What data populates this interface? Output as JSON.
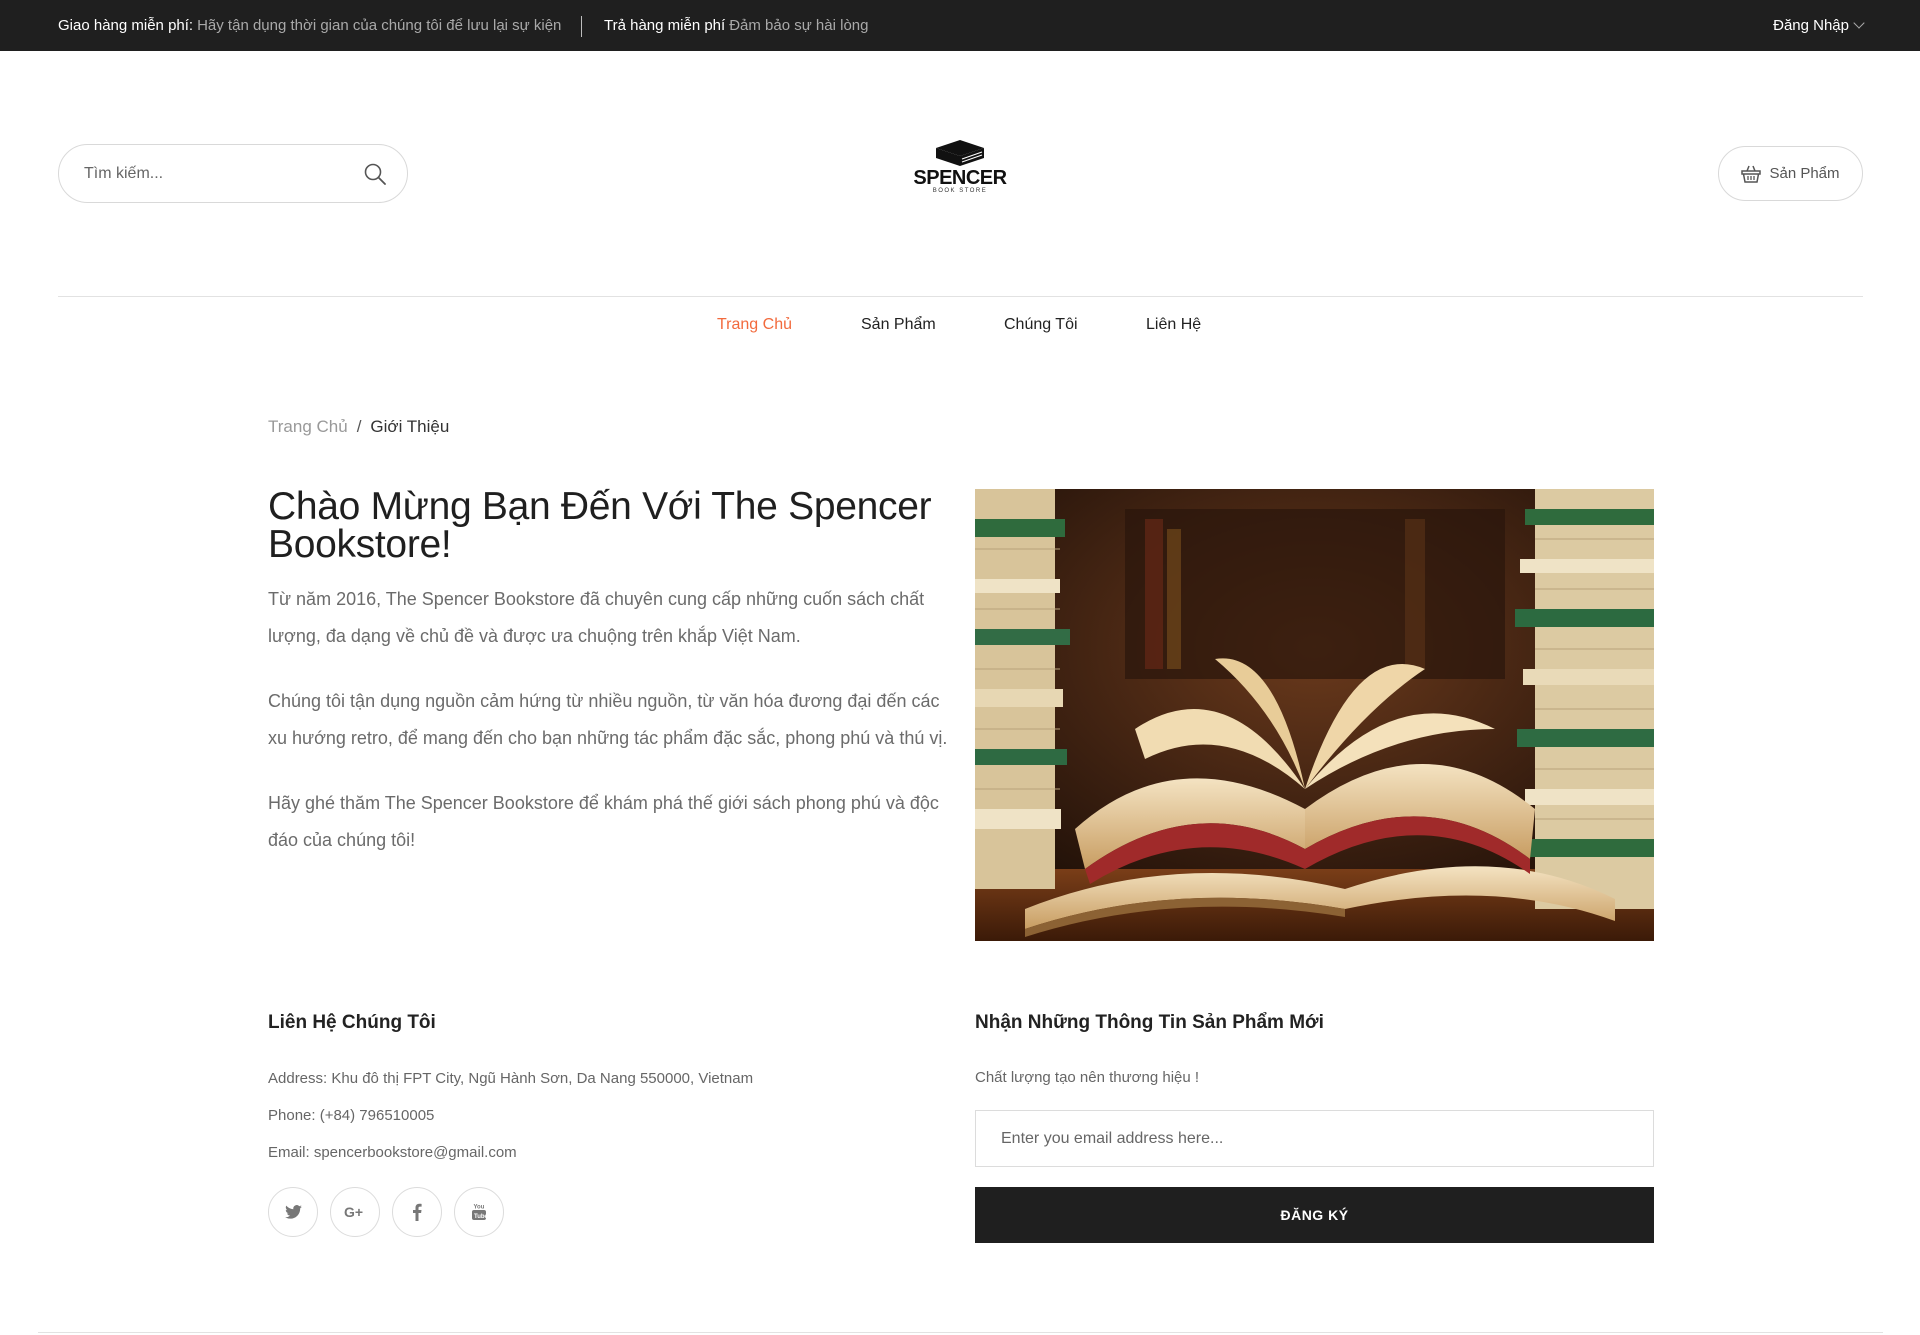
{
  "topbar": {
    "promo1_title": "Giao hàng miễn phí:",
    "promo1_text": "Hãy tận dụng thời gian của chúng tôi để lưu lại sự kiện",
    "promo2_title": "Trả hàng miễn phí",
    "promo2_text": "Đảm bảo sự hài lòng",
    "login_label": "Đăng Nhập"
  },
  "header": {
    "search_placeholder": "Tìm kiếm...",
    "logo_name": "SPENCER",
    "logo_sub": "BOOK STORE",
    "cart_label": "Sản Phẩm"
  },
  "nav": {
    "items": [
      {
        "label": "Trang Chủ",
        "active": true
      },
      {
        "label": "Sản Phẩm"
      },
      {
        "label": "Chúng Tôi"
      },
      {
        "label": "Liên Hệ"
      }
    ]
  },
  "breadcrumb": {
    "home": "Trang Chủ",
    "separator": "/",
    "current": "Giới Thiệu"
  },
  "intro": {
    "title": "Chào Mừng Bạn Đến Với The Spencer Bookstore!",
    "paragraphs": [
      "Từ năm 2016, The Spencer Bookstore đã chuyên cung cấp những cuốn sách chất lượng, đa dạng về chủ đề và được ưa chuộng trên khắp Việt Nam.",
      "Chúng tôi tận dụng nguồn cảm hứng từ nhiều nguồn, từ văn hóa đương đại đến các xu hướng retro, để mang đến cho bạn những tác phẩm đặc sắc, phong phú và thú vị.",
      "Hãy ghé thăm The Spencer Bookstore để khám phá thế giới sách phong phú và độc đáo của chúng tôi!"
    ]
  },
  "contact": {
    "title": "Liên Hệ Chúng Tôi",
    "address": "Address: Khu đô thị FPT City, Ngũ Hành Sơn, Da Nang 550000, Vietnam",
    "phone": "Phone: (+84) 796510005",
    "email": "Email: spencerbookstore@gmail.com",
    "socials": [
      "twitter-icon",
      "google-plus-icon",
      "facebook-icon",
      "youtube-icon"
    ]
  },
  "newsletter": {
    "title": "Nhận Những Thông Tin Sản Phẩm Mới",
    "tagline": "Chất lượng tạo nên thương hiệu !",
    "email_placeholder": "Enter you email address here...",
    "button_label": "ĐĂNG KÝ"
  },
  "colors": {
    "topbar_bg": "#1f1f1f",
    "accent": "#f26a3d",
    "button_bg": "#1f1f1f"
  }
}
